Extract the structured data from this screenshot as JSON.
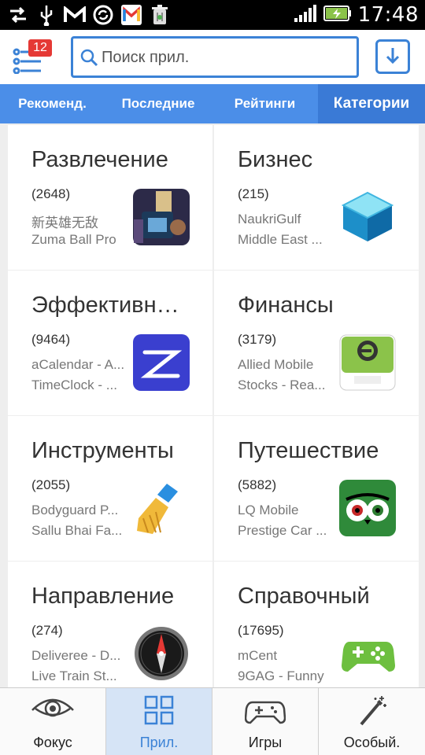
{
  "status_bar": {
    "time": "17:48",
    "icons": [
      "usb-transfer-icon",
      "usb-icon",
      "gmail-icon",
      "sync-icon",
      "gmail-color-icon",
      "trash-icon",
      "signal-icon",
      "battery-icon"
    ]
  },
  "header": {
    "badge_count": "12",
    "search_placeholder": "Поиск прил."
  },
  "tabs": [
    {
      "label": "Рекоменд.",
      "active": false
    },
    {
      "label": "Последние",
      "active": false
    },
    {
      "label": "Рейтинги",
      "active": false
    },
    {
      "label": "Категории",
      "active": true
    }
  ],
  "categories": [
    {
      "title": "Развлечение",
      "count": "(2648)",
      "app1": "新英雄无敌",
      "app2": "Zuma Ball Pro",
      "icon": "concert-photo-icon"
    },
    {
      "title": "Бизнес",
      "count": "(215)",
      "app1": "NaukriGulf",
      "app2": "Middle East ...",
      "icon": "blue-cube-icon"
    },
    {
      "title": "Эффективн…",
      "count": "(9464)",
      "app1": "aCalendar - A...",
      "app2": "TimeClock - ...",
      "icon": "z-app-icon"
    },
    {
      "title": "Финансы",
      "count": "(3179)",
      "app1": "Allied Mobile",
      "app2": "Stocks - Rea...",
      "icon": "e-service-icon"
    },
    {
      "title": "Инструменты",
      "count": "(2055)",
      "app1": "Bodyguard P...",
      "app2": "Sallu Bhai Fa...",
      "icon": "broom-icon"
    },
    {
      "title": "Путешествие",
      "count": "(5882)",
      "app1": "LQ Mobile",
      "app2": "Prestige Car ...",
      "icon": "owl-icon"
    },
    {
      "title": "Направление",
      "count": "(274)",
      "app1": "Deliveree - D...",
      "app2": "Live Train St...",
      "icon": "compass-icon"
    },
    {
      "title": "Справочный",
      "count": "(17695)",
      "app1": "mCent",
      "app2": "9GAG - Funny",
      "icon": "gamepad-icon"
    }
  ],
  "bottom_nav": [
    {
      "label": "Фокус",
      "icon": "eye-icon",
      "active": false
    },
    {
      "label": "Прил.",
      "icon": "apps-grid-icon",
      "active": true
    },
    {
      "label": "Игры",
      "icon": "gamepad-outline-icon",
      "active": false
    },
    {
      "label": "Особый.",
      "icon": "magic-wand-icon",
      "active": false
    }
  ],
  "colors": {
    "accent": "#3b82d6",
    "tab_bar": "#4b8ee8",
    "badge": "#e53935",
    "nav_active": "#d6e4f6"
  }
}
